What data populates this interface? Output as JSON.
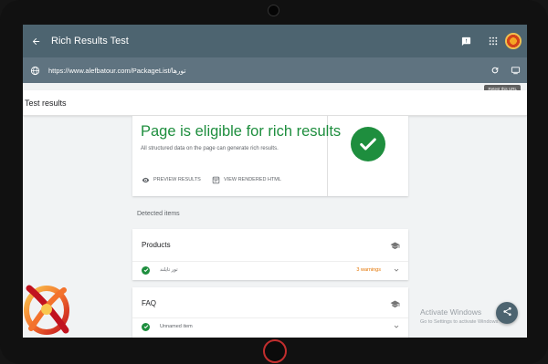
{
  "app": {
    "title": "Rich Results Test"
  },
  "url_bar": {
    "url": "https://www.alefbatour.com/PackageList/تورها",
    "tooltip": "Retest this URL"
  },
  "results": {
    "header": "Test results"
  },
  "summary": {
    "title": "Page is eligible for rich results",
    "subtitle": "All structured data on the page can generate rich results.",
    "preview_label": "PREVIEW RESULTS",
    "view_html_label": "VIEW RENDERED HTML"
  },
  "detected": {
    "label": "Detected items",
    "items": [
      {
        "title": "Products",
        "row_name": "تور تایلند",
        "status": "3 warnings"
      },
      {
        "title": "FAQ",
        "row_name": "Unnamed item",
        "status": ""
      }
    ]
  },
  "watermark": {
    "title": "Activate Windows",
    "subtitle": "Go to Settings to activate Windows."
  },
  "colors": {
    "toolbar": "#4d6470",
    "urlbar": "#5f7380",
    "success": "#1e8e3e",
    "warning": "#e37400"
  },
  "icons": [
    "back-arrow-icon",
    "feedback-icon",
    "apps-grid-icon",
    "globe-icon",
    "reload-icon",
    "desktop-icon",
    "eye-icon",
    "code-page-icon",
    "checkmark-icon",
    "graduation-cap-icon",
    "chevron-down-icon",
    "share-icon"
  ]
}
